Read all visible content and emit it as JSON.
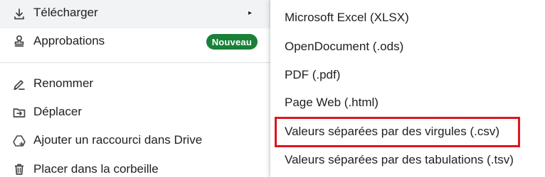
{
  "main_menu": {
    "items": [
      {
        "label": "Télécharger",
        "icon": "download-icon",
        "has_submenu": true,
        "submenu_arrow": "▸"
      },
      {
        "label": "Approbations",
        "icon": "approvals-stamp-icon",
        "badge": "Nouveau"
      },
      {
        "label": "Renommer",
        "icon": "rename-pencil-icon"
      },
      {
        "label": "Déplacer",
        "icon": "move-folder-icon"
      },
      {
        "label": "Ajouter un raccourci dans Drive",
        "icon": "add-shortcut-drive-icon"
      },
      {
        "label": "Placer dans la corbeille",
        "icon": "trash-icon"
      }
    ]
  },
  "download_submenu": {
    "items": [
      {
        "label": "Microsoft Excel (XLSX)"
      },
      {
        "label": "OpenDocument (.ods)"
      },
      {
        "label": "PDF (.pdf)"
      },
      {
        "label": "Page Web (.html)"
      },
      {
        "label": "Valeurs séparées par des virgules (.csv)",
        "highlighted": true
      },
      {
        "label": "Valeurs séparées par des tabulations (.tsv)"
      }
    ]
  },
  "colors": {
    "badge_bg": "#188038",
    "highlight_border": "#e0141e",
    "hover_bg": "#f1f3f4"
  }
}
